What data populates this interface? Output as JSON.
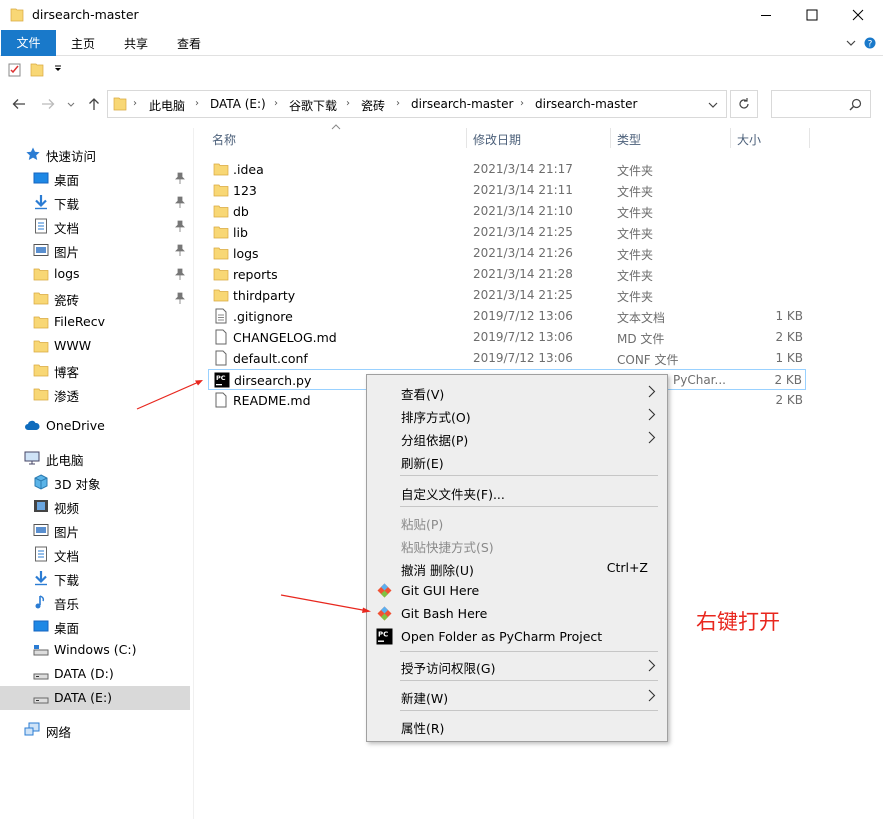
{
  "window": {
    "title": "dirsearch-master"
  },
  "ribbon": {
    "tabs": [
      "文件",
      "主页",
      "共享",
      "查看"
    ]
  },
  "breadcrumb": [
    "此电脑",
    "DATA (E:)",
    "谷歌下载",
    "瓷砖",
    "dirsearch-master",
    "dirsearch-master"
  ],
  "sidebar": {
    "quick_access": "快速访问",
    "pinned": [
      "桌面",
      "下载",
      "文档",
      "图片",
      "logs",
      "瓷砖"
    ],
    "folders": [
      "FileRecv",
      "WWW",
      "博客",
      "渗透"
    ],
    "onedrive": "OneDrive",
    "this_pc": "此电脑",
    "pc_items": [
      "3D 对象",
      "视频",
      "图片",
      "文档",
      "下载",
      "音乐",
      "桌面",
      "Windows (C:)",
      "DATA (D:)",
      "DATA (E:)"
    ],
    "network": "网络"
  },
  "columns": {
    "name": "名称",
    "date": "修改日期",
    "type": "类型",
    "size": "大小"
  },
  "files": [
    {
      "name": ".idea",
      "date": "2021/3/14 21:17",
      "type": "文件夹",
      "size": ""
    },
    {
      "name": "123",
      "date": "2021/3/14 21:11",
      "type": "文件夹",
      "size": ""
    },
    {
      "name": "db",
      "date": "2021/3/14 21:10",
      "type": "文件夹",
      "size": ""
    },
    {
      "name": "lib",
      "date": "2021/3/14 21:25",
      "type": "文件夹",
      "size": ""
    },
    {
      "name": "logs",
      "date": "2021/3/14 21:26",
      "type": "文件夹",
      "size": ""
    },
    {
      "name": "reports",
      "date": "2021/3/14 21:28",
      "type": "文件夹",
      "size": ""
    },
    {
      "name": "thirdparty",
      "date": "2021/3/14 21:25",
      "type": "文件夹",
      "size": ""
    },
    {
      "name": ".gitignore",
      "date": "2019/7/12 13:06",
      "type": "文本文档",
      "size": "1 KB"
    },
    {
      "name": "CHANGELOG.md",
      "date": "2019/7/12 13:06",
      "type": "MD 文件",
      "size": "2 KB"
    },
    {
      "name": "default.conf",
      "date": "2019/7/12 13:06",
      "type": "CONF 文件",
      "size": "1 KB"
    },
    {
      "name": "dirsearch.py",
      "date": "",
      "type": "PyChar...",
      "size": "2 KB"
    },
    {
      "name": "README.md",
      "date": "",
      "type": "",
      "size": "2 KB"
    }
  ],
  "context_menu": {
    "view": "查看(V)",
    "sort": "排序方式(O)",
    "group": "分组依据(P)",
    "refresh": "刷新(E)",
    "customize": "自定义文件夹(F)...",
    "paste": "粘贴(P)",
    "paste_shortcut": "粘贴快捷方式(S)",
    "undo": "撤消 删除(U)",
    "undo_shortcut": "Ctrl+Z",
    "git_gui": "Git GUI Here",
    "git_bash": "Git Bash Here",
    "pycharm": "Open Folder as PyCharm Project",
    "grant_access": "授予访问权限(G)",
    "new": "新建(W)",
    "properties": "属性(R)"
  },
  "annotation": "右键打开",
  "colors": {
    "accent": "#1979ca",
    "folder": "#f8d775",
    "annotation": "#e8271e",
    "selection": "#99d1ff"
  }
}
